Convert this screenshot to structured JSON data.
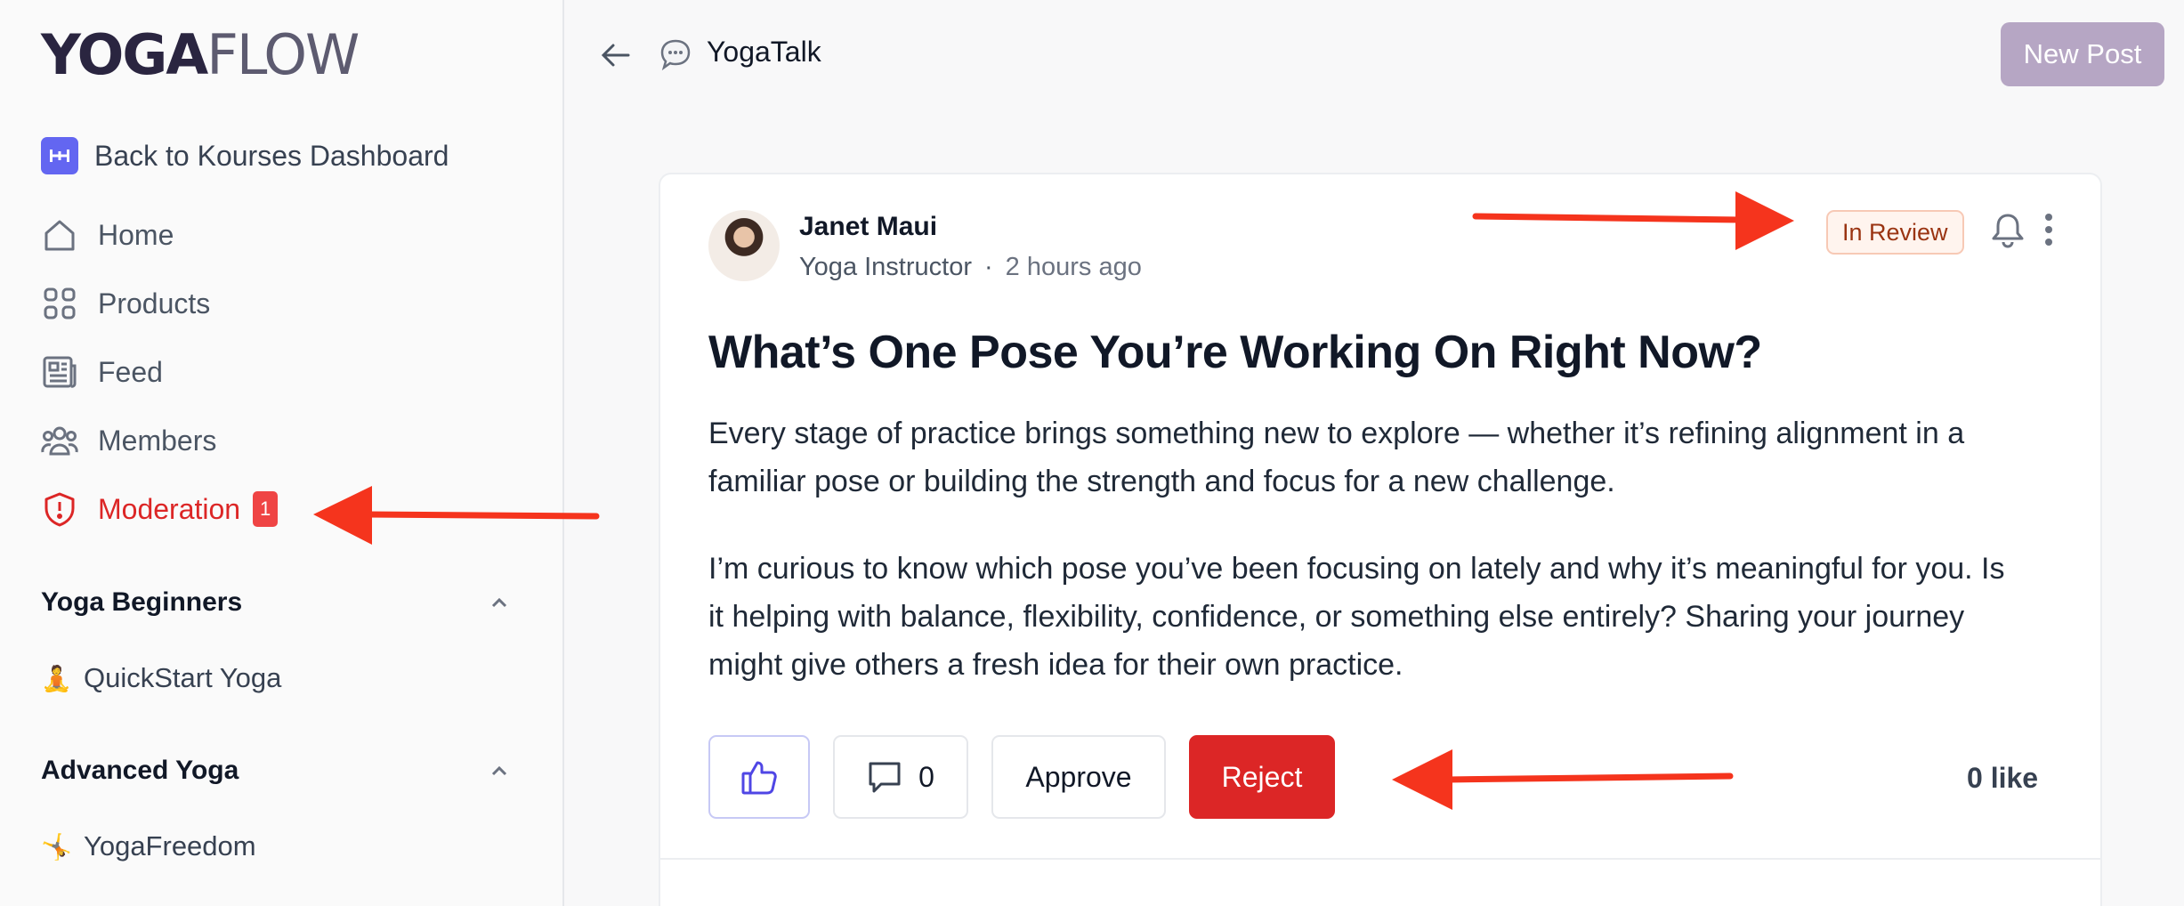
{
  "brand": {
    "logo_bold": "YOGA",
    "logo_light": "FLOW"
  },
  "sidebar": {
    "back_label": "Back to Kourses Dashboard",
    "nav": [
      {
        "label": "Home",
        "icon": "home-icon"
      },
      {
        "label": "Products",
        "icon": "grid-icon"
      },
      {
        "label": "Feed",
        "icon": "newspaper-icon"
      },
      {
        "label": "Members",
        "icon": "users-icon"
      },
      {
        "label": "Moderation",
        "icon": "shield-icon",
        "badge": "1",
        "active": true
      }
    ],
    "sections": [
      {
        "title": "Yoga Beginners",
        "items": [
          {
            "emoji": "🧘",
            "label": "QuickStart Yoga"
          }
        ]
      },
      {
        "title": "Advanced Yoga",
        "items": [
          {
            "emoji": "🤸",
            "label": "YogaFreedom"
          }
        ]
      }
    ]
  },
  "header": {
    "title": "YogaTalk",
    "new_post_label": "New Post"
  },
  "post": {
    "author": "Janet Maui",
    "role": "Yoga Instructor",
    "separator": "·",
    "time": "2 hours ago",
    "status": "In Review",
    "title": "What’s One Pose You’re Working On Right Now?",
    "paragraphs": [
      "Every stage of practice brings something new to explore — whether it’s refining alignment in a familiar pose or building the strength and focus for a new challenge.",
      "I’m curious to know which pose you’ve been focusing on lately and why it’s meaningful for you. Is it helping with balance, flexibility, confidence, or something else entirely? Sharing your journey might give others a fresh idea for their own practice."
    ],
    "comment_count": "0",
    "approve_label": "Approve",
    "reject_label": "Reject",
    "likes_text": "0 like"
  },
  "colors": {
    "accent": "#dc2626",
    "brand_purple": "#6366f1",
    "new_post_bg": "#b6a6c4",
    "annotation_arrow": "#f5341d"
  }
}
